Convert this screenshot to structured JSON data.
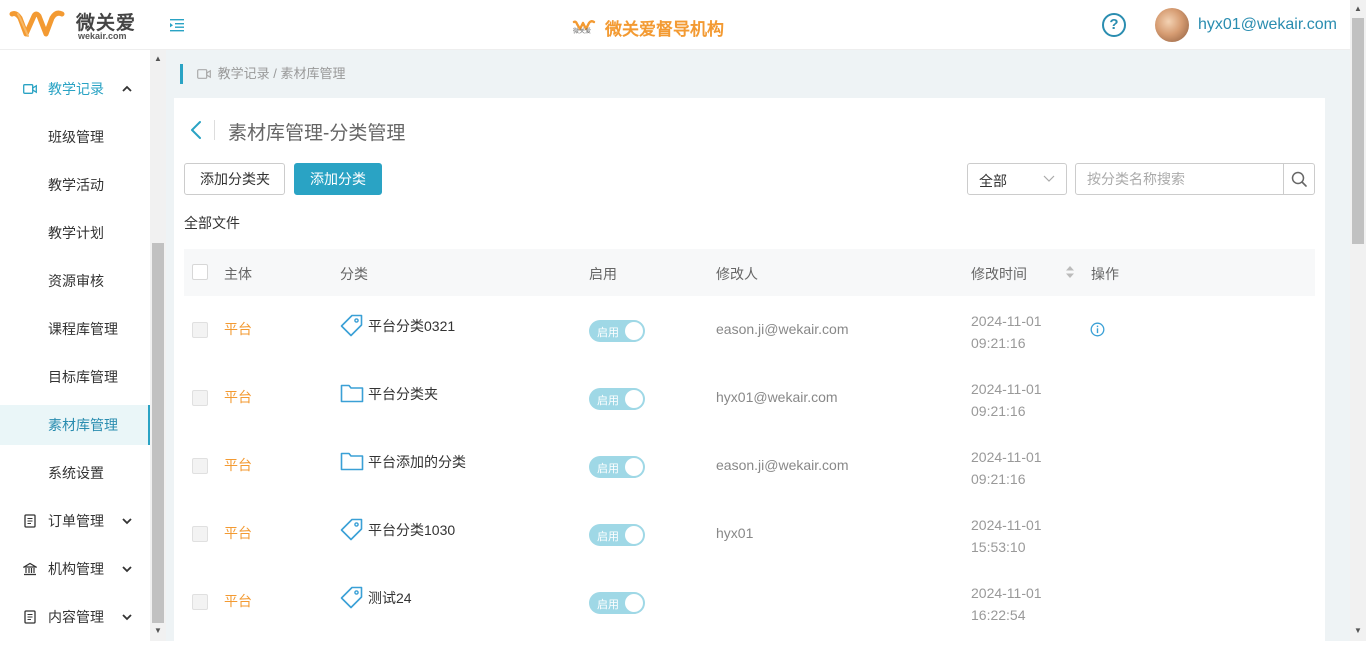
{
  "brand": {
    "logo_text": "微关爱",
    "logo_domain": "wekair.com",
    "center_logo_sub": "微关爱",
    "center_title": "微关爱督导机构"
  },
  "header": {
    "help_glyph": "?",
    "user_email": "hyx01@wekair.com"
  },
  "sidebar": {
    "items": [
      {
        "label": "教学记录",
        "type": "group",
        "expanded": true,
        "icon": "video-icon"
      },
      {
        "label": "班级管理",
        "type": "child"
      },
      {
        "label": "教学活动",
        "type": "child"
      },
      {
        "label": "教学计划",
        "type": "child"
      },
      {
        "label": "资源审核",
        "type": "child"
      },
      {
        "label": "课程库管理",
        "type": "child"
      },
      {
        "label": "目标库管理",
        "type": "child"
      },
      {
        "label": "素材库管理",
        "type": "child",
        "active": true
      },
      {
        "label": "系统设置",
        "type": "child"
      },
      {
        "label": "订单管理",
        "type": "group",
        "expanded": false,
        "icon": "document-icon"
      },
      {
        "label": "机构管理",
        "type": "group",
        "expanded": false,
        "icon": "bank-icon"
      },
      {
        "label": "内容管理",
        "type": "group",
        "expanded": false,
        "icon": "document-icon"
      }
    ]
  },
  "breadcrumb": {
    "part1": "教学记录",
    "sep": " / ",
    "part2": "素材库管理"
  },
  "page": {
    "title": "素材库管理-分类管理",
    "add_folder_label": "添加分类夹",
    "add_category_label": "添加分类",
    "filter_value": "全部",
    "search_placeholder": "按分类名称搜索",
    "all_files_label": "全部文件"
  },
  "table": {
    "headers": {
      "subject": "主体",
      "category": "分类",
      "enabled": "启用",
      "modifier": "修改人",
      "modified_time": "修改时间",
      "actions": "操作"
    },
    "rows": [
      {
        "subject": "平台",
        "category": "平台分类0321",
        "icon": "tag-icon",
        "enabled": "启用",
        "modifier": "eason.ji@wekair.com",
        "date": "2024-11-01",
        "time": "09:21:16",
        "has_info": true
      },
      {
        "subject": "平台",
        "category": "平台分类夹",
        "icon": "folder-icon",
        "enabled": "启用",
        "modifier": "hyx01@wekair.com",
        "date": "2024-11-01",
        "time": "09:21:16",
        "has_info": false
      },
      {
        "subject": "平台",
        "category": "平台添加的分类",
        "icon": "folder-icon",
        "enabled": "启用",
        "modifier": "eason.ji@wekair.com",
        "date": "2024-11-01",
        "time": "09:21:16",
        "has_info": false
      },
      {
        "subject": "平台",
        "category": "平台分类1030",
        "icon": "tag-icon",
        "enabled": "启用",
        "modifier": "hyx01",
        "date": "2024-11-01",
        "time": "15:53:10",
        "has_info": false
      },
      {
        "subject": "平台",
        "category": "测试24",
        "icon": "tag-icon",
        "enabled": "启用",
        "modifier": "",
        "date": "2024-11-01",
        "time": "16:22:54",
        "has_info": false
      }
    ]
  },
  "colors": {
    "accent": "#2aa3c4",
    "orange": "#f39a32"
  }
}
